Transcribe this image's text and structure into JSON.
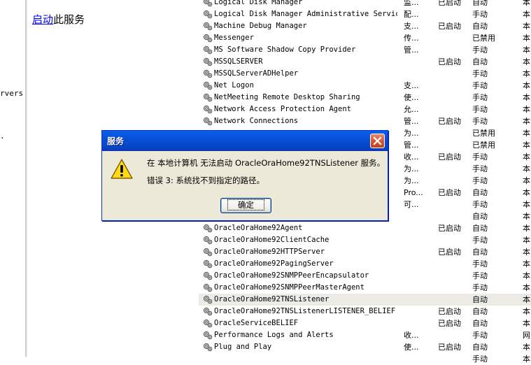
{
  "left_fragment": {
    "text": "rvers",
    "dot": "."
  },
  "left_panel": {
    "link_text": "启动",
    "rest_text": "此服务"
  },
  "services": [
    {
      "name": "Logical Disk Manager",
      "desc": "监...",
      "status": "已启动",
      "startup": "自动",
      "logon": "本"
    },
    {
      "name": "Logical Disk Manager Administrative Service",
      "desc": "配...",
      "status": "",
      "startup": "手动",
      "logon": "本"
    },
    {
      "name": "Machine Debug Manager",
      "desc": "支...",
      "status": "已启动",
      "startup": "自动",
      "logon": "本"
    },
    {
      "name": "Messenger",
      "desc": "传...",
      "status": "",
      "startup": "已禁用",
      "logon": "本"
    },
    {
      "name": "MS Software Shadow Copy Provider",
      "desc": "管...",
      "status": "",
      "startup": "手动",
      "logon": "本"
    },
    {
      "name": "MSSQLSERVER",
      "desc": "",
      "status": "已启动",
      "startup": "自动",
      "logon": "本"
    },
    {
      "name": "MSSQLServerADHelper",
      "desc": "",
      "status": "",
      "startup": "手动",
      "logon": "本"
    },
    {
      "name": "Net Logon",
      "desc": "支...",
      "status": "",
      "startup": "手动",
      "logon": "本"
    },
    {
      "name": "NetMeeting Remote Desktop Sharing",
      "desc": "使...",
      "status": "",
      "startup": "手动",
      "logon": "本"
    },
    {
      "name": "Network Access Protection Agent",
      "desc": "允...",
      "status": "",
      "startup": "手动",
      "logon": "本"
    },
    {
      "name": "Network Connections",
      "desc": "管...",
      "status": "已启动",
      "startup": "手动",
      "logon": "本"
    },
    {
      "name": "",
      "desc": "为...",
      "status": "",
      "startup": "已禁用",
      "logon": "本"
    },
    {
      "name": "",
      "desc": "管...",
      "status": "",
      "startup": "已禁用",
      "logon": "本"
    },
    {
      "name": "",
      "desc": "收...",
      "status": "已启动",
      "startup": "手动",
      "logon": "本"
    },
    {
      "name": "",
      "desc": "为...",
      "status": "",
      "startup": "手动",
      "logon": "本"
    },
    {
      "name": "",
      "desc": "为...",
      "status": "",
      "startup": "手动",
      "logon": "本"
    },
    {
      "name": "",
      "desc": "Pro...",
      "status": "已启动",
      "startup": "自动",
      "logon": "本"
    },
    {
      "name": "",
      "desc": "可...",
      "status": "",
      "startup": "手动",
      "logon": "本"
    },
    {
      "name": "",
      "desc": "",
      "status": "",
      "startup": "自动",
      "logon": "本"
    },
    {
      "name": "OracleOraHome92Agent",
      "desc": "",
      "status": "已启动",
      "startup": "自动",
      "logon": "本"
    },
    {
      "name": "OracleOraHome92ClientCache",
      "desc": "",
      "status": "",
      "startup": "手动",
      "logon": "本"
    },
    {
      "name": "OracleOraHome92HTTPServer",
      "desc": "",
      "status": "已启动",
      "startup": "自动",
      "logon": "本"
    },
    {
      "name": "OracleOraHome92PagingServer",
      "desc": "",
      "status": "",
      "startup": "手动",
      "logon": "本"
    },
    {
      "name": "OracleOraHome92SNMPPeerEncapsulator",
      "desc": "",
      "status": "",
      "startup": "手动",
      "logon": "本"
    },
    {
      "name": "OracleOraHome92SNMPPeerMasterAgent",
      "desc": "",
      "status": "",
      "startup": "手动",
      "logon": "本"
    },
    {
      "name": "OracleOraHome92TNSListener",
      "desc": "",
      "status": "",
      "startup": "自动",
      "logon": "本"
    },
    {
      "name": "OracleOraHome92TNSListenerLISTENER_BELIEF",
      "desc": "",
      "status": "已启动",
      "startup": "自动",
      "logon": "本"
    },
    {
      "name": "OracleServiceBELIEF",
      "desc": "",
      "status": "已启动",
      "startup": "自动",
      "logon": "本"
    },
    {
      "name": "Performance Logs and Alerts",
      "desc": "收...",
      "status": "",
      "startup": "手动",
      "logon": "网"
    },
    {
      "name": "Plug and Play",
      "desc": "使...",
      "status": "已启动",
      "startup": "自动",
      "logon": "本"
    },
    {
      "name": "",
      "desc": "",
      "status": "",
      "startup": "手动",
      "logon": "本"
    }
  ],
  "selected_row": 25,
  "dialog": {
    "title": "服务",
    "message_line1": "在 本地计算机 无法启动 OracleOraHome92TNSListener 服务。",
    "message_line2": "错误 3: 系统找不到指定的路径。",
    "ok_label": "确定"
  },
  "colors": {
    "titlebar": "#0a5fe8",
    "dialog_bg": "#ece9d8",
    "link": "#0000ee"
  }
}
